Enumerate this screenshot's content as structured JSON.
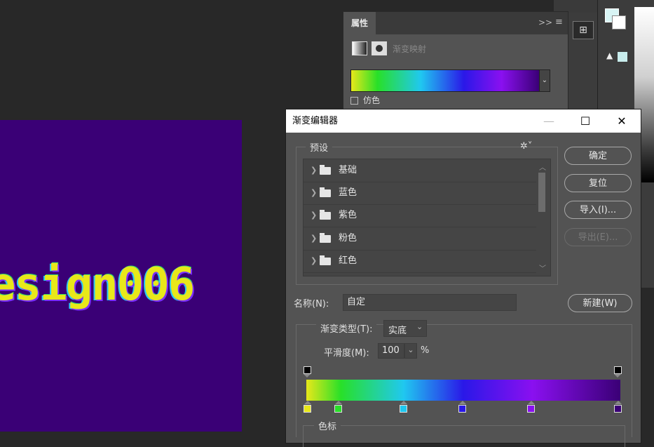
{
  "canvas": {
    "text": "esign006",
    "background": "#3a0076"
  },
  "properties_panel": {
    "tab_label": "属性",
    "collapse_icon": "double-chevron-right-icon",
    "menu_icon": "hamburger-icon",
    "adjustment_label": "渐变映射",
    "dither_label": "仿色"
  },
  "dialog": {
    "title": "渐变编辑器",
    "window_buttons": {
      "minimize": "—",
      "maximize": "☐",
      "close": "✕"
    },
    "presets": {
      "label": "预设",
      "gear_icon": "gear-icon",
      "items": [
        {
          "label": "基础"
        },
        {
          "label": "蓝色"
        },
        {
          "label": "紫色"
        },
        {
          "label": "粉色"
        },
        {
          "label": "红色"
        }
      ]
    },
    "buttons": {
      "ok": "确定",
      "reset": "复位",
      "import": "导入(I)...",
      "export": "导出(E)...",
      "new": "新建(W)"
    },
    "name": {
      "label": "名称(N):",
      "value": "自定"
    },
    "gradient_type": {
      "label": "渐变类型(T):",
      "value": "实底"
    },
    "smoothness": {
      "label": "平滑度(M):",
      "value": "100",
      "unit": "%"
    },
    "color_stops": [
      "#e8e81a",
      "#28e028",
      "#20c8f0",
      "#2a18e8",
      "#8a10f0",
      "#3a0076"
    ],
    "color_stops_label": "色标"
  },
  "colors": {
    "panel_bg": "#535353",
    "app_bg": "#282828",
    "canvas_bg": "#3a0076",
    "text_yellow": "#e8e81a"
  }
}
